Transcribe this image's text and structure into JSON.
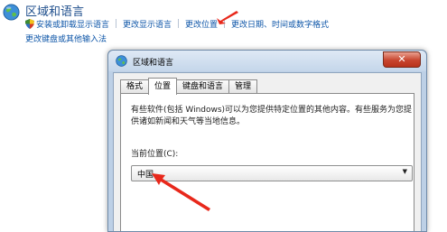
{
  "control_panel": {
    "title": "区域和语言",
    "links_row1": [
      {
        "label": "安装或卸载显示语言",
        "has_shield": true
      },
      {
        "label": "更改显示语言"
      },
      {
        "label": "更改位置"
      },
      {
        "label": "更改日期、时间或数字格式"
      }
    ],
    "link_row2": "更改键盘或其他输入法"
  },
  "dialog": {
    "title": "区域和语言",
    "close_glyph": "✕",
    "tabs": [
      "格式",
      "位置",
      "键盘和语言",
      "管理"
    ],
    "active_tab": "位置",
    "description": "有些软件(包括 Windows)可以为您提供特定位置的其他内容。有些服务为您提供诸如新闻和天气等当地信息。",
    "current_location_label": "当前位置(C):",
    "current_location_value": "中国",
    "dropdown_arrow_glyph": "▼"
  },
  "icons": {
    "globe": "globe-icon",
    "shield": "uac-shield-icon",
    "title": "region-icon",
    "dropdown": "chevron-down-icon"
  },
  "colors": {
    "link": "#0e56a8",
    "title": "#1e4e8c",
    "annotation": "#e8281b",
    "close_button": "#c8452e"
  }
}
